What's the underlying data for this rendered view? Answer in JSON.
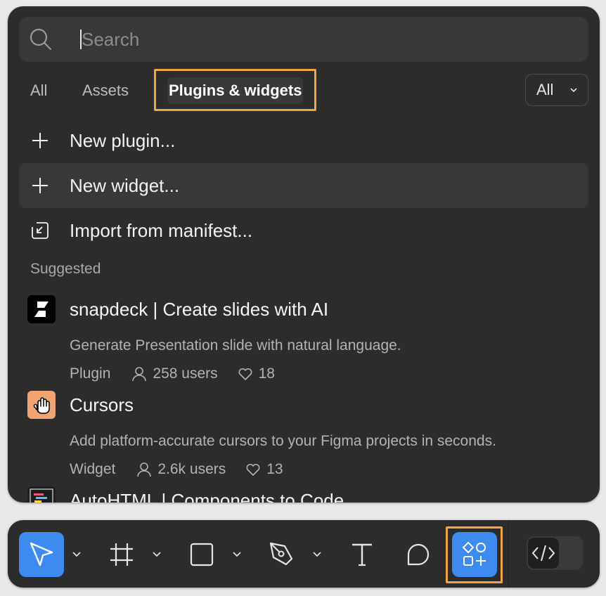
{
  "search": {
    "placeholder": "Search"
  },
  "tabs": [
    {
      "label": "All"
    },
    {
      "label": "Assets"
    },
    {
      "label": "Plugins & widgets",
      "active": true
    }
  ],
  "filter": {
    "label": "All",
    "icon": "chevron-down-icon"
  },
  "actions": [
    {
      "label": "New plugin...",
      "icon": "plus-icon"
    },
    {
      "label": "New widget...",
      "icon": "plus-icon",
      "hovered": true
    },
    {
      "label": "Import from manifest...",
      "icon": "import-icon"
    }
  ],
  "section_title": "Suggested",
  "suggestions": [
    {
      "title": "snapdeck | Create slides with AI",
      "description": "Generate Presentation slide with natural language.",
      "kind": "Plugin",
      "users": "258 users",
      "likes": "18",
      "icon": "snapdeck-logo"
    },
    {
      "title": "Cursors",
      "description": "Add platform-accurate cursors to your Figma projects in seconds.",
      "kind": "Widget",
      "users": "2.6k users",
      "likes": "13",
      "icon": "cursors-hand-logo"
    },
    {
      "title": "AutoHTML | Components to Code",
      "icon": "autohtml-logo"
    }
  ],
  "toolbar": {
    "tools": [
      {
        "name": "move",
        "icon": "cursor-arrow-icon",
        "active": true
      },
      {
        "name": "frame",
        "icon": "frame-hash-icon"
      },
      {
        "name": "shape",
        "icon": "rectangle-icon"
      },
      {
        "name": "pen",
        "icon": "pen-nib-icon"
      },
      {
        "name": "text",
        "icon": "text-t-icon"
      },
      {
        "name": "comment",
        "icon": "comment-bubble-icon"
      },
      {
        "name": "resources",
        "icon": "resources-shapes-icon",
        "active": true
      }
    ],
    "dev_mode": {
      "icon": "code-brackets-icon",
      "on": false
    }
  },
  "colors": {
    "panel_bg": "#2c2c2c",
    "hover_bg": "#383838",
    "accent_blue": "#3d8bf0",
    "highlight_orange": "#f2a541",
    "cursors_logo_bg": "#f0a373"
  }
}
